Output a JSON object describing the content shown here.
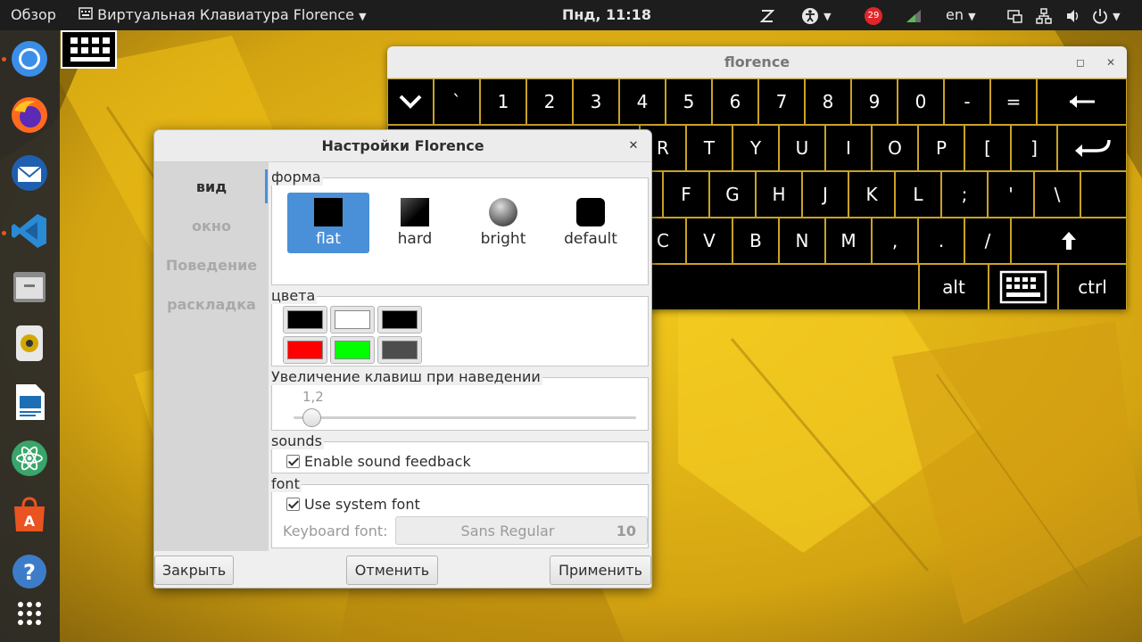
{
  "topbar": {
    "activities": "Обзор",
    "app_menu": "Виртуальная Клавиатура Florence",
    "clock": "Пнд, 11:18",
    "notification_count": "29",
    "keyboard_layout": "en"
  },
  "dock": {
    "items": [
      "chromium-icon",
      "firefox-icon",
      "thunderbird-icon",
      "vscode-icon",
      "files-icon",
      "rhythmbox-icon",
      "writer-icon",
      "atom-icon",
      "software-icon",
      "help-icon",
      "apps-grid-icon"
    ]
  },
  "florence": {
    "title": "florence",
    "keys": {
      "row1": [
        "`",
        "1",
        "2",
        "3",
        "4",
        "5",
        "6",
        "7",
        "8",
        "9",
        "0",
        "-",
        "="
      ],
      "row2": [
        "R",
        "T",
        "Y",
        "U",
        "I",
        "O",
        "P",
        "[",
        "]"
      ],
      "row3": [
        "F",
        "G",
        "H",
        "J",
        "K",
        "L",
        ";",
        "'",
        "\\"
      ],
      "row4": [
        "C",
        "V",
        "B",
        "N",
        "M",
        ",",
        ".",
        "/"
      ],
      "alt": "alt",
      "ctrl": "ctrl"
    }
  },
  "settings": {
    "title": "Настройки Florence",
    "sidebar": [
      "вид",
      "окно",
      "Поведение",
      "раскладка"
    ],
    "shape": {
      "label": "форма",
      "options": [
        "flat",
        "hard",
        "bright",
        "default"
      ],
      "selected": "flat"
    },
    "colors": {
      "label": "цвета",
      "swatches": [
        "#000000",
        "#ffffff",
        "#000000",
        "#ff0000",
        "#00ff00",
        "#4d4d4d"
      ]
    },
    "zoom": {
      "label": "Увеличение клавиш при наведении",
      "value": "1,2"
    },
    "sounds": {
      "label": "sounds",
      "checkbox": "Enable sound feedback",
      "checked": true
    },
    "font": {
      "label": "font",
      "checkbox": "Use system font",
      "checked": true,
      "keyboard_font_label": "Keyboard font:",
      "font_name": "Sans Regular",
      "font_size": "10"
    },
    "buttons": {
      "close": "Закрыть",
      "cancel": "Отменить",
      "apply": "Применить"
    }
  }
}
